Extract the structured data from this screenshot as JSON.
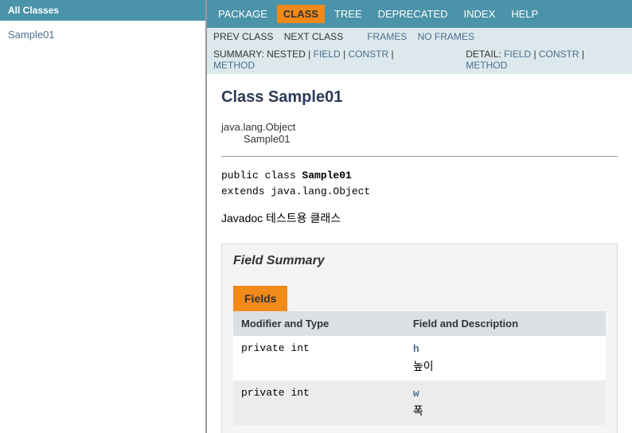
{
  "sidebar": {
    "header": "All Classes",
    "items": [
      {
        "label": "Sample01"
      }
    ]
  },
  "topnav": [
    {
      "label": "PACKAGE",
      "active": false
    },
    {
      "label": "CLASS",
      "active": true
    },
    {
      "label": "TREE",
      "active": false
    },
    {
      "label": "DEPRECATED",
      "active": false
    },
    {
      "label": "INDEX",
      "active": false
    },
    {
      "label": "HELP",
      "active": false
    }
  ],
  "subnav": {
    "prev": "PREV CLASS",
    "next": "NEXT CLASS",
    "frames": "FRAMES",
    "noframes": "NO FRAMES"
  },
  "summarynav": {
    "summary_prefix": "SUMMARY:",
    "nested": "NESTED",
    "field": "FIELD",
    "constr": "CONSTR",
    "method": "METHOD",
    "detail_prefix": "DETAIL:",
    "d_field": "FIELD",
    "d_constr": "CONSTR",
    "d_method": "METHOD",
    "sep": " | "
  },
  "content": {
    "title": "Class Sample01",
    "inheritance": {
      "parent": "java.lang.Object",
      "child": "Sample01"
    },
    "declaration": {
      "line1_pre": "public class ",
      "line1_name": "Sample01",
      "line2": "extends java.lang.Object"
    },
    "description": "Javadoc 테스트용 클래스",
    "field_summary": {
      "heading": "Field Summary",
      "caption": "Fields",
      "cols": {
        "c1": "Modifier and Type",
        "c2": "Field and Description"
      },
      "rows": [
        {
          "modtype": "private int",
          "name": "h",
          "desc": "높이"
        },
        {
          "modtype": "private int",
          "name": "w",
          "desc": "폭"
        }
      ]
    }
  }
}
